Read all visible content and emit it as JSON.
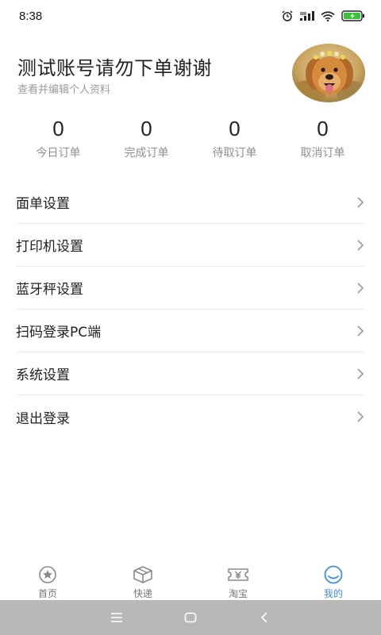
{
  "status_bar": {
    "time": "8:38",
    "icons": [
      "alarm-icon",
      "signal-icon",
      "wifi-icon",
      "battery-charging-icon"
    ]
  },
  "profile": {
    "name": "测试账号请勿下单谢谢",
    "subtitle": "查看并编辑个人资料",
    "avatar": "dog-photo"
  },
  "stats": [
    {
      "value": "0",
      "label": "今日订单"
    },
    {
      "value": "0",
      "label": "完成订单"
    },
    {
      "value": "0",
      "label": "待取订单"
    },
    {
      "value": "0",
      "label": "取消订单"
    }
  ],
  "menu": [
    {
      "label": "面单设置"
    },
    {
      "label": "打印机设置"
    },
    {
      "label": "蓝牙秤设置"
    },
    {
      "label": "扫码登录PC端"
    },
    {
      "label": "系统设置"
    },
    {
      "label": "退出登录"
    }
  ],
  "tabbar": {
    "tabs": [
      {
        "label": "首页",
        "icon": "star-icon"
      },
      {
        "label": "快递",
        "icon": "package-icon"
      },
      {
        "label": "淘宝",
        "icon": "ticket-icon"
      },
      {
        "label": "我的",
        "icon": "smile-icon"
      }
    ],
    "active_index": 3,
    "active_color": "#3d8fe8",
    "inactive_color": "#777777"
  },
  "system_nav": {
    "buttons": [
      "menu-icon",
      "home-icon",
      "back-icon"
    ],
    "background": "#b8b8b8"
  }
}
